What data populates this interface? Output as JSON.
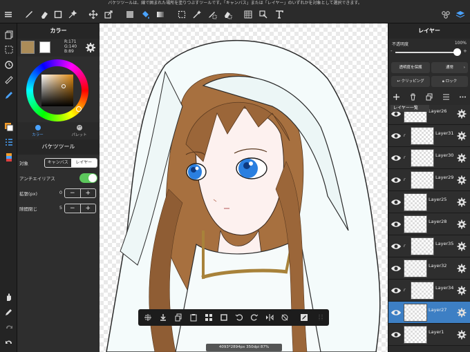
{
  "hint": "バケツツールは、線で囲まれた場所を塗りつぶすツールです。「キャンバス」または「レイヤー」のいずれかを対象として選択できます。",
  "toolbar": {
    "icons": [
      "menu-icon",
      "eraser-icon",
      "square-icon",
      "magic-wand-icon",
      "move-icon",
      "transform-icon",
      "fill-color-icon",
      "bucket-icon",
      "gradient-icon",
      "select-rect-icon",
      "wand-select-icon",
      "pen-select-icon",
      "eraser-select-icon",
      "tile-icon",
      "shortcut-icon",
      "text-icon",
      "material-icon",
      "layers-icon"
    ]
  },
  "color_panel": {
    "title": "カラー",
    "main_color": "#ab8c59",
    "r": "R:171",
    "g": "G:140",
    "b": "B:89",
    "tab_color": "カラー",
    "tab_palette": "パレット"
  },
  "bucket": {
    "title": "バケツツール",
    "target_label": "対象",
    "target_canvas": "キャンバス",
    "target_layer": "レイヤー",
    "antialias_label": "アンチエイリアス",
    "antialias_on": true,
    "expand_label": "拡張(px)",
    "expand_value": "0",
    "close_gap_label": "隙間閉じ",
    "close_gap_value": "5",
    "minus": "−",
    "plus": "+"
  },
  "canvas": {
    "info": "4093*2894px 350dpi 87%"
  },
  "layer_panel": {
    "title": "レイヤー",
    "opacity_label": "不透明度",
    "opacity_value": "100%",
    "opacity_fraction": 1.0,
    "minus": "-",
    "plus": "+",
    "protect_label": "透明度を保護",
    "blend_label": "通常",
    "clipping_label": "クリッピング",
    "lock_label": "ロック",
    "list_header": "レイヤー一覧",
    "layers": [
      {
        "name": "Layer26",
        "clip": false,
        "selected": false
      },
      {
        "name": "Layer31",
        "clip": true,
        "selected": false
      },
      {
        "name": "Layer30",
        "clip": true,
        "selected": false
      },
      {
        "name": "Layer29",
        "clip": true,
        "selected": false
      },
      {
        "name": "Layer25",
        "clip": false,
        "selected": false
      },
      {
        "name": "Layer28",
        "clip": false,
        "selected": false
      },
      {
        "name": "Layer35",
        "clip": true,
        "selected": false
      },
      {
        "name": "Layer32",
        "clip": false,
        "selected": false
      },
      {
        "name": "Layer34",
        "clip": true,
        "selected": false
      },
      {
        "name": "Layer27",
        "clip": false,
        "selected": true
      },
      {
        "name": "Layer1",
        "clip": false,
        "selected": false
      }
    ]
  },
  "colors": {
    "accent": "#3d7fc4",
    "toggle_on": "#5cc85c",
    "panel": "#2e2e2e"
  }
}
